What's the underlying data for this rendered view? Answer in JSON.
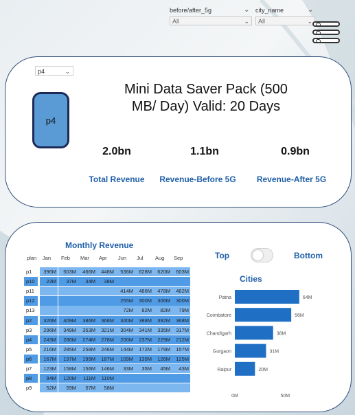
{
  "filters": [
    {
      "label": "before/after_5g",
      "value": "All"
    },
    {
      "label": "city_name",
      "value": "All"
    }
  ],
  "plan_select": {
    "value": "p4"
  },
  "plan_badge": "p4",
  "pack_title_line1": "Mini Data Saver Pack (500",
  "pack_title_line2": "MB/ Day) Valid: 20 Days",
  "kpis": [
    {
      "value": "2.0bn",
      "label": "Total Revenue"
    },
    {
      "value": "1.1bn",
      "label": "Revenue-Before 5G"
    },
    {
      "value": "0.9bn",
      "label": "Revenue-After 5G"
    }
  ],
  "monthly": {
    "title": "Monthly Revenue",
    "header": [
      "plan",
      "Jan",
      "Feb",
      "Mar",
      "Apr",
      "Jun",
      "Jul",
      "Aug",
      "Sep"
    ],
    "rows": [
      {
        "plan": "p1",
        "highlight": false,
        "values": [
          "396M",
          "503M",
          "466M",
          "448M",
          "536M",
          "628M",
          "620M",
          "603M"
        ]
      },
      {
        "plan": "p10",
        "highlight": true,
        "values": [
          "23M",
          "37M",
          "34M",
          "38M",
          "",
          "",
          "",
          ""
        ]
      },
      {
        "plan": "p11",
        "highlight": false,
        "values": [
          "",
          "",
          "",
          "",
          "414M",
          "486M",
          "478M",
          "482M"
        ]
      },
      {
        "plan": "p12",
        "highlight": true,
        "values": [
          "",
          "",
          "",
          "",
          "255M",
          "300M",
          "306M",
          "300M"
        ]
      },
      {
        "plan": "p13",
        "highlight": false,
        "values": [
          "",
          "",
          "",
          "",
          "72M",
          "82M",
          "82M",
          "79M"
        ]
      },
      {
        "plan": "p2",
        "highlight": true,
        "values": [
          "326M",
          "409M",
          "386M",
          "368M",
          "340M",
          "388M",
          "392M",
          "368M"
        ]
      },
      {
        "plan": "p3",
        "highlight": false,
        "values": [
          "296M",
          "349M",
          "353M",
          "321M",
          "304M",
          "341M",
          "335M",
          "317M"
        ]
      },
      {
        "plan": "p4",
        "highlight": true,
        "values": [
          "243M",
          "280M",
          "274M",
          "278M",
          "200M",
          "237M",
          "229M",
          "212M"
        ]
      },
      {
        "plan": "p5",
        "highlight": false,
        "values": [
          "216M",
          "285M",
          "258M",
          "246M",
          "144M",
          "172M",
          "179M",
          "157M"
        ]
      },
      {
        "plan": "p6",
        "highlight": true,
        "values": [
          "167M",
          "197M",
          "199M",
          "187M",
          "109M",
          "135M",
          "126M",
          "125M"
        ]
      },
      {
        "plan": "p7",
        "highlight": false,
        "values": [
          "123M",
          "158M",
          "156M",
          "146M",
          "33M",
          "35M",
          "45M",
          "43M"
        ]
      },
      {
        "plan": "p8",
        "highlight": true,
        "values": [
          "94M",
          "120M",
          "111M",
          "110M",
          "",
          "",
          "",
          ""
        ]
      },
      {
        "plan": "p9",
        "highlight": false,
        "values": [
          "52M",
          "59M",
          "57M",
          "58M",
          "",
          "",
          "",
          ""
        ]
      }
    ]
  },
  "toggle": {
    "left_label": "Top",
    "right_label": "Bottom",
    "state": "off"
  },
  "chart_data": {
    "type": "bar",
    "orientation": "horizontal",
    "title": "Cities",
    "categories": [
      "Patna",
      "Coimbatore",
      "Chandigarh",
      "Gurgaon",
      "Raipur"
    ],
    "values": [
      64,
      56,
      38,
      31,
      20
    ],
    "data_labels": [
      "64M",
      "56M",
      "38M",
      "31M",
      "20M"
    ],
    "xlim": [
      0,
      75
    ],
    "x_ticks": [
      0,
      50
    ],
    "x_tick_labels": [
      "0M",
      "50M"
    ],
    "bar_color": "#1f6fc5",
    "grid": false
  },
  "colors": {
    "accent": "#1f5fa8",
    "badge_fill": "#5b9bd5",
    "badge_border": "#1b2a57",
    "matrix_cell_light": "#7db7f0",
    "matrix_cell_dark": "#4f9be6"
  }
}
